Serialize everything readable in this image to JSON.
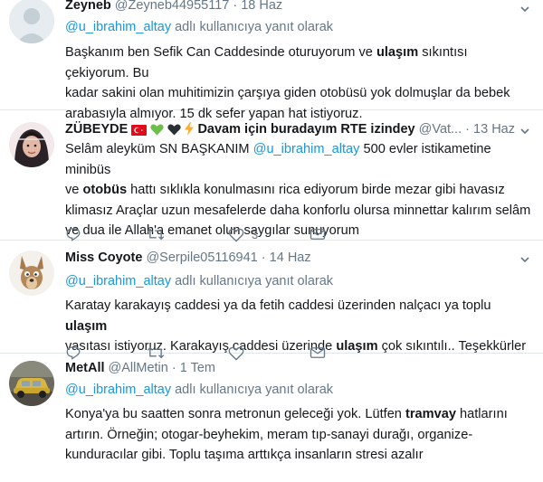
{
  "tweets": [
    {
      "name": "Zeyneb",
      "handle": "@Zeyneb44955117",
      "time": "18 Haz",
      "replying_mention": "@u_ibrahim_altay",
      "replying_text": " adlı kullanıcıya yanıt olarak",
      "line1_a": "Başkanım ben Sefik Can Caddesinde oturuyorum ve ",
      "line1_bold": "ulaşım",
      "line1_b": " sıkıntısı çekiyorum. Bu",
      "line2": "kadar  sakini olan muhitimizin çarşıya giden otobüsü yok dolmuşlar da bebek",
      "line3": "arabasıyla almıyor. 15 dk sefer yapan hat istiyoruz."
    },
    {
      "name": "ZÜBEYDE",
      "tagline": "Davam için buradayım RTE izindey",
      "handle": "@Vat...",
      "time": "13 Haz",
      "line1_a": "Selâm aleyküm SN BAŞKANIM ",
      "line1_mention": "@u_ibrahim_altay",
      "line1_b": " 500 evler istikametine minibüs",
      "line2_a": "ve ",
      "line2_bold": "otobüs",
      "line2_b": " hattı sıklıkla konulmasını rica ediyorum birde mezar gibi havasız",
      "line3": "klimasız Araçlar uzun mesafelerde daha konforlu olursa minnettar kalırım selâm",
      "line4": "ve dua ile Allah'a emanet olun saygılar sunuyorum",
      "like_count": "3"
    },
    {
      "name": "Miss Coyote",
      "handle": "@Serpile05116941",
      "time": "14 Haz",
      "replying_mention": "@u_ibrahim_altay",
      "replying_text": " adlı kullanıcıya yanıt olarak",
      "line1_a": "Karatay karakayış caddesi ya da fetih caddesi üzerinden nalçacı ya toplu ",
      "line1_bold": "ulaşım",
      "line2_a": "vasıtası istiyoruz. Karakayış caddesi üzerinde ",
      "line2_bold": "ulaşım",
      "line2_b": " çok sıkıntılı.. Teşekkürler"
    },
    {
      "name": "MetAll",
      "handle": "@AllMetin",
      "time": "1 Tem",
      "replying_mention": "@u_ibrahim_altay",
      "replying_text": " adlı kullanıcıya yanıt olarak",
      "line1_a": "Konya'ya bu saatten sonra metronun geleceği yok. Lütfen ",
      "line1_bold": "tramvay",
      "line1_b": " hatlarını",
      "line2": "artırın. Örneğin; otogar-beyhekim,  meram tıp-sanayi durağı, organize-",
      "line3": "kunduracılar gibi. Toplu taşıma arttıkça insanların stresi azalır"
    }
  ],
  "separator": "·"
}
